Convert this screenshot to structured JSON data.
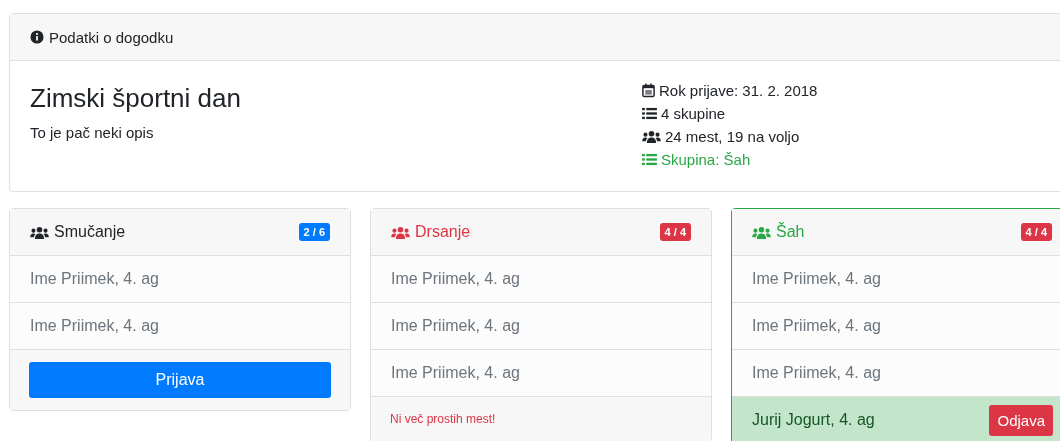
{
  "event_card": {
    "header": "Podatki o dogodku",
    "title": "Zimski športni dan",
    "description": "To je pač neki opis",
    "meta": [
      {
        "kind": "calendar",
        "text": "Rok prijave: 31. 2. 2018",
        "highlight": false
      },
      {
        "kind": "list",
        "text": "4 skupine",
        "highlight": false
      },
      {
        "kind": "users",
        "text": "24 mest, 19 na voljo",
        "highlight": false
      },
      {
        "kind": "list",
        "text": "Skupina: Šah",
        "highlight": true
      }
    ]
  },
  "groups": [
    {
      "name": "Smučanje",
      "kind": "open",
      "badge": "2 / 6",
      "members": [
        {
          "name": "Ime Priimek, 4. ag",
          "self": false
        },
        {
          "name": "Ime Priimek, 4. ag",
          "self": false
        }
      ],
      "footer": {
        "kind": "button",
        "text": "Prijava"
      }
    },
    {
      "name": "Drsanje",
      "kind": "full",
      "badge": "4 / 4",
      "members": [
        {
          "name": "Ime Priimek, 4. ag",
          "self": false
        },
        {
          "name": "Ime Priimek, 4. ag",
          "self": false
        },
        {
          "name": "Ime Priimek, 4. ag",
          "self": false
        }
      ],
      "footer": {
        "kind": "message",
        "text": "Ni več prostih mest!"
      }
    },
    {
      "name": "Šah",
      "kind": "joined",
      "badge": "4 / 4",
      "members": [
        {
          "name": "Ime Priimek, 4. ag",
          "self": false
        },
        {
          "name": "Ime Priimek, 4. ag",
          "self": false
        },
        {
          "name": "Ime Priimek, 4. ag",
          "self": false
        },
        {
          "name": "Jurij Jogurt, 4. ag",
          "self": true,
          "action": "Odjava"
        }
      ]
    }
  ]
}
